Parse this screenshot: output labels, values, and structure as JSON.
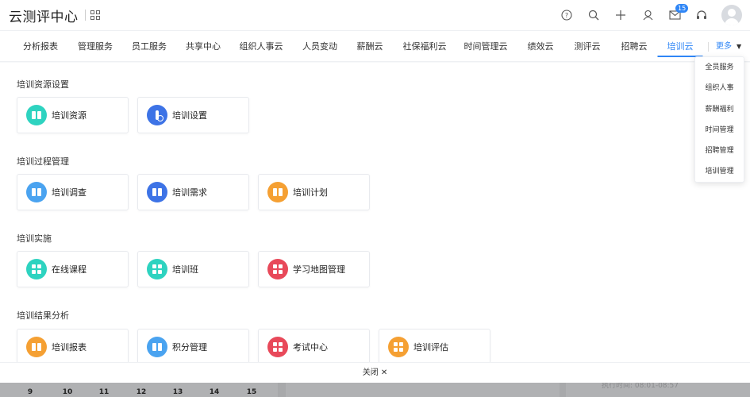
{
  "header": {
    "logo": "云测评中心",
    "mail_badge": "15"
  },
  "nav": {
    "items": [
      "分析报表",
      "管理服务",
      "员工服务",
      "共享中心",
      "组织人事云",
      "人员变动",
      "薪酬云",
      "社保福利云",
      "时间管理云",
      "绩效云",
      "测评云",
      "招聘云",
      "培训云"
    ],
    "active": "培训云",
    "more_label": "更多"
  },
  "dropdown": {
    "items": [
      "全员服务",
      "组织人事",
      "薪酬福利",
      "时间管理",
      "招聘管理",
      "培训管理"
    ]
  },
  "sections": [
    {
      "title": "培训资源设置",
      "cards": [
        {
          "label": "培训资源",
          "icon": "book-icon",
          "color": "#2ed3c0"
        },
        {
          "label": "培训设置",
          "icon": "gear-icon",
          "color": "#3d73e6"
        }
      ]
    },
    {
      "title": "培训过程管理",
      "cards": [
        {
          "label": "培训调查",
          "icon": "book-icon",
          "color": "#4aa3f0"
        },
        {
          "label": "培训需求",
          "icon": "book-icon",
          "color": "#3d73e6"
        },
        {
          "label": "培训计划",
          "icon": "book-icon",
          "color": "#f5a033"
        }
      ]
    },
    {
      "title": "培训实施",
      "cards": [
        {
          "label": "在线课程",
          "icon": "grid-icon",
          "color": "#2ed3c0"
        },
        {
          "label": "培训班",
          "icon": "grid-icon",
          "color": "#2ed3c0"
        },
        {
          "label": "学习地图管理",
          "icon": "grid-icon",
          "color": "#e8495a"
        }
      ]
    },
    {
      "title": "培训结果分析",
      "cards": [
        {
          "label": "培训报表",
          "icon": "book-icon",
          "color": "#f5a033"
        },
        {
          "label": "积分管理",
          "icon": "book-icon",
          "color": "#4aa3f0"
        },
        {
          "label": "考试中心",
          "icon": "grid-icon",
          "color": "#e8495a"
        },
        {
          "label": "培训评估",
          "icon": "grid-icon",
          "color": "#f5a033"
        }
      ]
    }
  ],
  "close_label": "关闭 ✕",
  "underlay": {
    "days": [
      "9",
      "10",
      "11",
      "12",
      "13",
      "14",
      "15"
    ],
    "text": "执行时间: 08:01-08:57"
  },
  "colors": {
    "accent": "#2f86f6"
  }
}
